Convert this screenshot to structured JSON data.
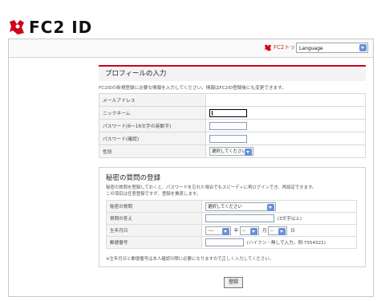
{
  "brand": {
    "logo_text": "FC2 ID",
    "accent": "#d0021b"
  },
  "topbar": {
    "link_label": "FC2トップ",
    "language": "Language"
  },
  "profile": {
    "title": "プロフィールの入力",
    "description": "FC2IDの新規登録に必要な情報を入力してください。情報はFC2ID登録後にも変更できます。",
    "rows": [
      {
        "label": "メールアドレス"
      },
      {
        "label": "ニックネーム"
      },
      {
        "label": "パスワード(6〜16文字の英数字)"
      },
      {
        "label": "パスワード(確認)"
      },
      {
        "label": "性別",
        "select_value": "選択してください"
      }
    ]
  },
  "secret": {
    "title": "秘密の質問の登録",
    "description_1": "秘密の質問を登録しておくと、パスワードを忘れた場合でもスピーディに再ログインでき、再設定できます。",
    "description_2": "この項目は任意登録ですが、登録を推奨します。",
    "rows": {
      "question_label": "秘密の質問",
      "question_value": "選択してください",
      "answer_label": "質問の答え",
      "answer_hint": "(3文字以上)",
      "birth_label": "生年月日",
      "year_value": "----",
      "year_unit": "年",
      "month_value": "--",
      "month_unit": "月",
      "day_value": "--",
      "day_unit": "日",
      "zip_label": "郵便番号",
      "zip_hint": "(ハイフン・無しで入力。例:7554321)"
    },
    "note": "※生年月日と郵便番号は本人確認の際に必要になりますので正しく入力してください。"
  },
  "submit_label": "登録"
}
